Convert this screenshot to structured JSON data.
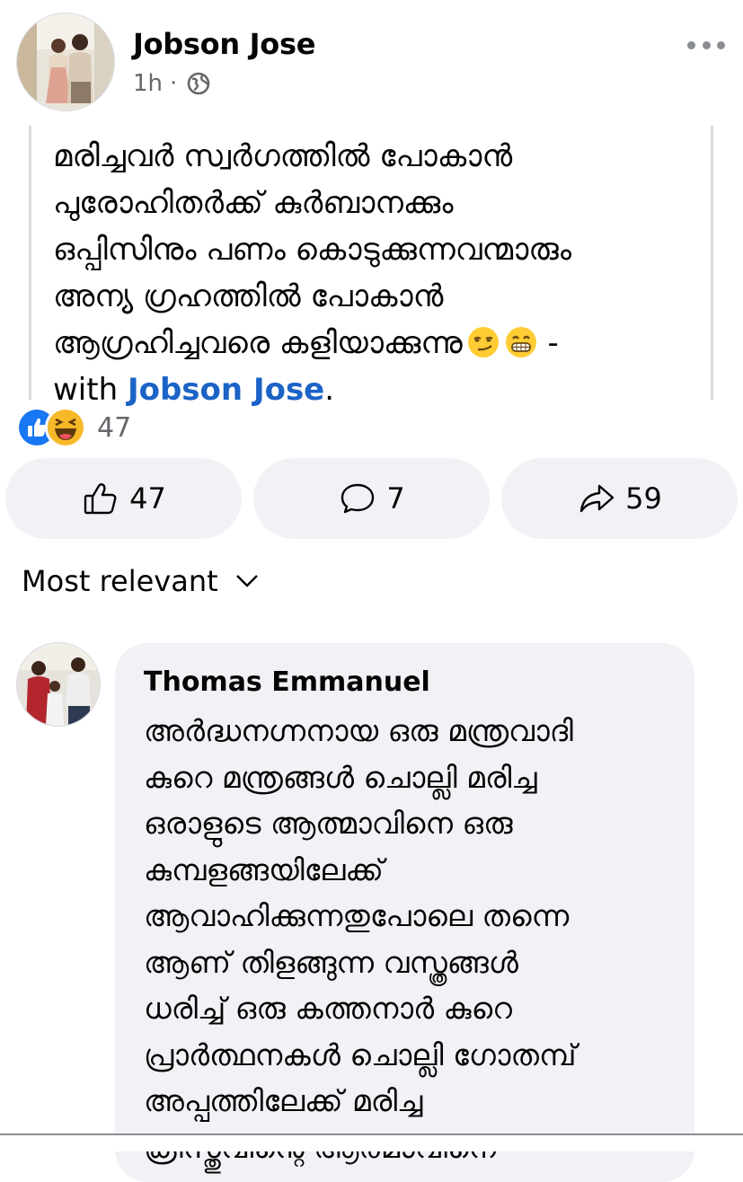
{
  "post": {
    "author": "Jobson Jose",
    "time": "1h",
    "separator": "·",
    "audience_icon": "globe-icon",
    "more_icon": "more-dots-icon",
    "text_lines": [
      "മരിച്ചവർ സ്വർഗത്തിൽ പോകാൻ",
      "പുരോഹിതർക്ക് കുർബാനക്കും",
      "ഒപ്പിസിനും പണം കൊടുക്കുന്നവന്മാരും",
      "അന്യ ഗ്രഹത്തിൽ പോകാൻ",
      "ആഗ്രഹിച്ചവരെ കളിയാക്കുന്നു"
    ],
    "emojis": [
      "smirk-emoji",
      "grin-emoji"
    ],
    "dash": " -",
    "with_prefix": "with ",
    "tagged_name": "Jobson Jose",
    "tag_suffix": "."
  },
  "reactions": {
    "icons": [
      "like-reaction-icon",
      "haha-reaction-icon"
    ],
    "count": "47"
  },
  "actions": {
    "like_count": "47",
    "comment_count": "7",
    "share_count": "59"
  },
  "sort": {
    "label": "Most relevant"
  },
  "comment": {
    "author": "Thomas Emmanuel",
    "text_lines": [
      "അർദ്ധനഗ്നനായ ഒരു മന്ത്രവാദി",
      "കുറെ മന്ത്രങ്ങൾ ചൊല്ലി മരിച്ച",
      "ഒരാളുടെ ആത്മാവിനെ ഒരു",
      "കുമ്പളങ്ങയിലേക്ക്",
      "ആവാഹിക്കുന്നതുപോലെ തന്നെ",
      "ആണ് തിളങ്ങുന്ന വസ്ത്രങ്ങൾ",
      "ധരിച്ച് ഒരു കത്തനാർ കുറെ",
      "പ്രാർത്ഥനകൾ ചൊല്ലി ഗോതമ്പ്",
      "അപ്പത്തിലേക്ക് മരിച്ച",
      "ക്രിസ്തുവിന്റെ ആത്മാവിനെ"
    ]
  },
  "colors": {
    "link_blue": "#1b63c6",
    "muted_gray": "#65676b",
    "button_bg": "#f0f2f5",
    "like_blue": "#1877f2",
    "haha_yellow": "#f7b928"
  }
}
